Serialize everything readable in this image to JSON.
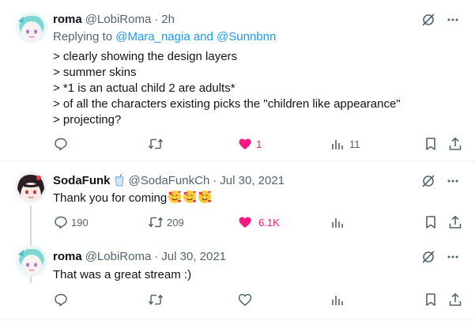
{
  "tweets": [
    {
      "name": "roma",
      "handle": "@LobiRoma",
      "sep": "·",
      "time": "2h",
      "replying_prefix": "Replying to ",
      "replying_link": "@Mara_nagia and @Sunnbnn",
      "lines": [
        "> clearly showing the design layers",
        "> summer skins",
        "> *1 is an actual child 2 are adults*",
        "> of all the characters existing picks the \"children like appearance\"",
        "> projecting?"
      ],
      "actions": {
        "reply": "",
        "retweet": "",
        "like": "1",
        "views": "11"
      }
    },
    {
      "name": "SodaFunk",
      "handle": "@SodaFunkCh",
      "sep": "·",
      "time": "Jul 30, 2021",
      "text": "Thank you for coming",
      "emoji": [
        "smiling-face-with-hearts",
        "smiling-face-with-hearts",
        "smiling-face-with-hearts"
      ],
      "actions": {
        "reply": "190",
        "retweet": "209",
        "like": "6.1K",
        "views": ""
      }
    },
    {
      "name": "roma",
      "handle": "@LobiRoma",
      "sep": "·",
      "time": "Jul 30, 2021",
      "text": "That was a great stream :)",
      "actions": {
        "reply": "",
        "retweet": "",
        "like": "",
        "views": ""
      }
    }
  ],
  "colors": {
    "like_active": "#f91880",
    "link": "#1d9bf0",
    "muted": "#536471"
  }
}
